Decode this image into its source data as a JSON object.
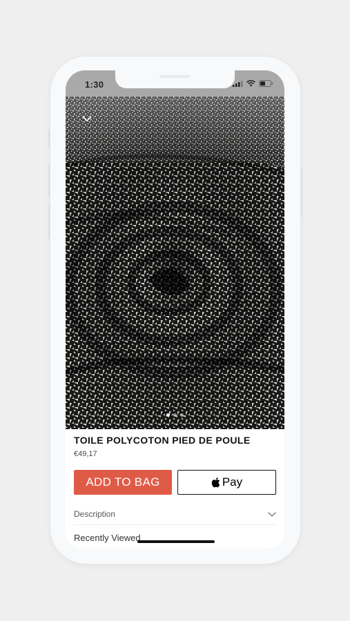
{
  "status_bar": {
    "time": "1:30",
    "icons": [
      "cellular-signal-icon",
      "wifi-icon",
      "battery-icon"
    ]
  },
  "product": {
    "image_alt_icon": "houndstooth-fabric-image",
    "carousel": {
      "count": 3,
      "active_index": 0
    },
    "title": "TOILE POLYCOTON PIED DE POULE",
    "price": "€49,17"
  },
  "actions": {
    "add_to_bag": "ADD TO BAG",
    "apple_pay_label": "Pay"
  },
  "sections": {
    "description": "Description",
    "recently_viewed": "Recently Viewed"
  },
  "colors": {
    "accent": "#e05b47",
    "status_bar_bg": "#a9a9a9",
    "background": "#efefef"
  }
}
